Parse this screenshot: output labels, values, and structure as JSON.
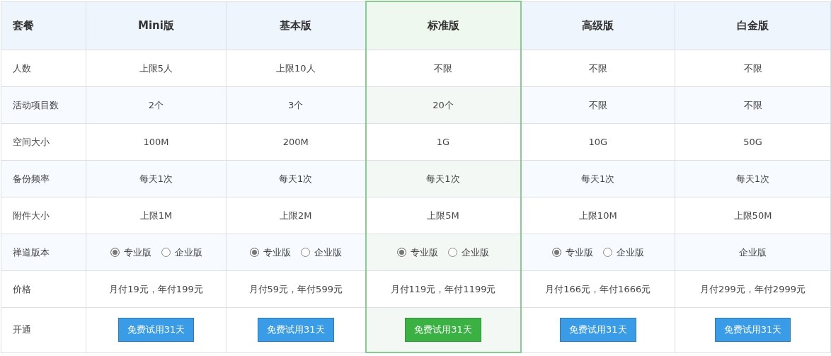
{
  "header_label": "套餐",
  "plans": [
    {
      "name": "Mini版",
      "selected": false
    },
    {
      "name": "基本版",
      "selected": false
    },
    {
      "name": "标准版",
      "selected": true
    },
    {
      "name": "高级版",
      "selected": false
    },
    {
      "name": "白金版",
      "selected": false
    }
  ],
  "rows": [
    {
      "label": "人数",
      "kind": "text",
      "cells": [
        "上限5人",
        "上限10人",
        "不限",
        "不限",
        "不限"
      ]
    },
    {
      "label": "活动项目数",
      "kind": "text",
      "cells": [
        "2个",
        "3个",
        "20个",
        "不限",
        "不限"
      ]
    },
    {
      "label": "空间大小",
      "kind": "text",
      "cells": [
        "100M",
        "200M",
        "1G",
        "10G",
        "50G"
      ]
    },
    {
      "label": "备份频率",
      "kind": "text",
      "cells": [
        "每天1次",
        "每天1次",
        "每天1次",
        "每天1次",
        "每天1次"
      ]
    },
    {
      "label": "附件大小",
      "kind": "text",
      "cells": [
        "上限1M",
        "上限2M",
        "上限5M",
        "上限10M",
        "上限50M"
      ]
    },
    {
      "label": "禅道版本",
      "kind": "choice",
      "cells": [
        {
          "kind": "radio",
          "options": [
            {
              "label": "专业版",
              "selected": true
            },
            {
              "label": "企业版",
              "selected": false
            }
          ]
        },
        {
          "kind": "radio",
          "options": [
            {
              "label": "专业版",
              "selected": true
            },
            {
              "label": "企业版",
              "selected": false
            }
          ]
        },
        {
          "kind": "radio",
          "options": [
            {
              "label": "专业版",
              "selected": true
            },
            {
              "label": "企业版",
              "selected": false
            }
          ]
        },
        {
          "kind": "radio",
          "options": [
            {
              "label": "专业版",
              "selected": true
            },
            {
              "label": "企业版",
              "selected": false
            }
          ]
        },
        {
          "kind": "text",
          "text": "企业版"
        }
      ]
    },
    {
      "label": "价格",
      "kind": "text",
      "cells": [
        "月付19元，年付199元",
        "月付59元，年付599元",
        "月付119元，年付1199元",
        "月付166元，年付1666元",
        "月付299元，年付2999元"
      ]
    },
    {
      "label": "开通",
      "kind": "button",
      "cells": [
        "免费试用31天",
        "免费试用31天",
        "免费试用31天",
        "免费试用31天",
        "免费试用31天"
      ]
    }
  ]
}
